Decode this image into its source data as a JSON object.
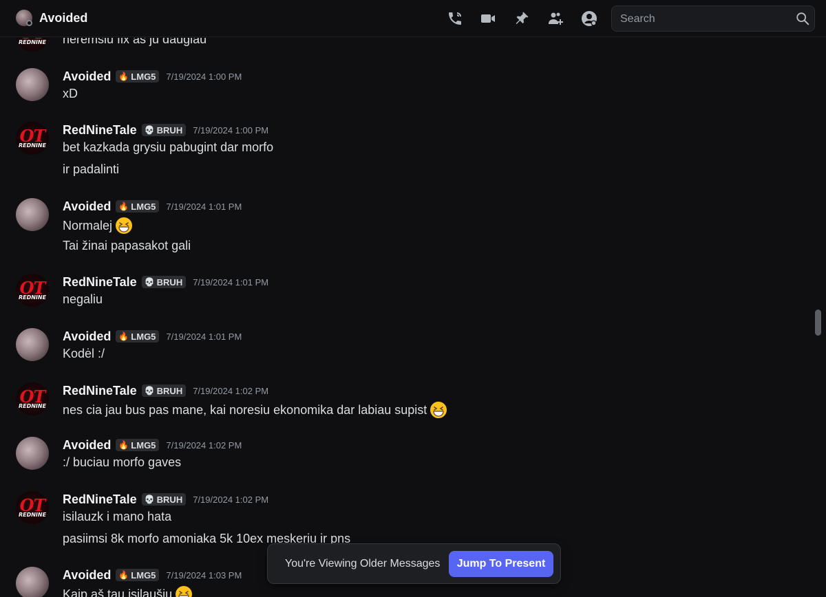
{
  "header": {
    "title": "Avoided",
    "search_placeholder": "Search",
    "icons": [
      "voice-call-icon",
      "video-call-icon",
      "pinned-messages-icon",
      "add-friends-icon",
      "user-profile-icon",
      "search-icon"
    ]
  },
  "partial_top_message": "neremsiu fix as ju daugiau",
  "users": {
    "avoided": {
      "name": "Avoided",
      "tag": "LMG5",
      "tag_icon": "green-flame-icon"
    },
    "red": {
      "name": "RedNineTale",
      "tag": "BRUH",
      "tag_icon": "skull-icon",
      "avatar_text": "OT",
      "avatar_subtext": "REDNINE"
    }
  },
  "messages": [
    {
      "author": "Avoided",
      "tag": "LMG5",
      "timestamp": "7/19/2024 1:00 PM",
      "lines": [
        "xD"
      ]
    },
    {
      "author": "RedNineTale",
      "tag": "BRUH",
      "timestamp": "7/19/2024 1:00 PM",
      "lines": [
        "bet kazkada grysiu pabugint dar morfo",
        "ir padalinti"
      ]
    },
    {
      "author": "Avoided",
      "tag": "LMG5",
      "timestamp": "7/19/2024 1:01 PM",
      "lines": [
        "Normalej",
        "Tai žinai papasakot gali"
      ]
    },
    {
      "author": "RedNineTale",
      "tag": "BRUH",
      "timestamp": "7/19/2024 1:01 PM",
      "lines": [
        "negaliu"
      ]
    },
    {
      "author": "Avoided",
      "tag": "LMG5",
      "timestamp": "7/19/2024 1:01 PM",
      "lines": [
        "Kodėl :/"
      ]
    },
    {
      "author": "RedNineTale",
      "tag": "BRUH",
      "timestamp": "7/19/2024 1:02 PM",
      "lines": [
        "nes cia jau bus pas mane, kai noresiu ekonomika dar labiau supist"
      ]
    },
    {
      "author": "Avoided",
      "tag": "LMG5",
      "timestamp": "7/19/2024 1:02 PM",
      "lines": [
        ":/ buciau morfo gaves"
      ]
    },
    {
      "author": "RedNineTale",
      "tag": "BRUH",
      "timestamp": "7/19/2024 1:02 PM",
      "lines": [
        "isilauzk i mano hata",
        "pasiimsi 8k morfo amoniaka 5k 10ex meskeriu ir pns"
      ]
    },
    {
      "author": "Avoided",
      "tag": "LMG5",
      "timestamp": "7/19/2024 1:03 PM",
      "lines": [
        "Kaip aš tau įsilaušiu"
      ]
    }
  ],
  "emoji": {
    "grin": "grinning-squinting-emoji"
  },
  "older_messages_bar": {
    "text": "You're Viewing Older Messages",
    "button": "Jump To Present"
  },
  "colors": {
    "background": "#0f0f11",
    "accent": "#5865f2",
    "username": "#f2f3f5",
    "timestamp": "#949ba4",
    "flame": "#3ba55d"
  }
}
